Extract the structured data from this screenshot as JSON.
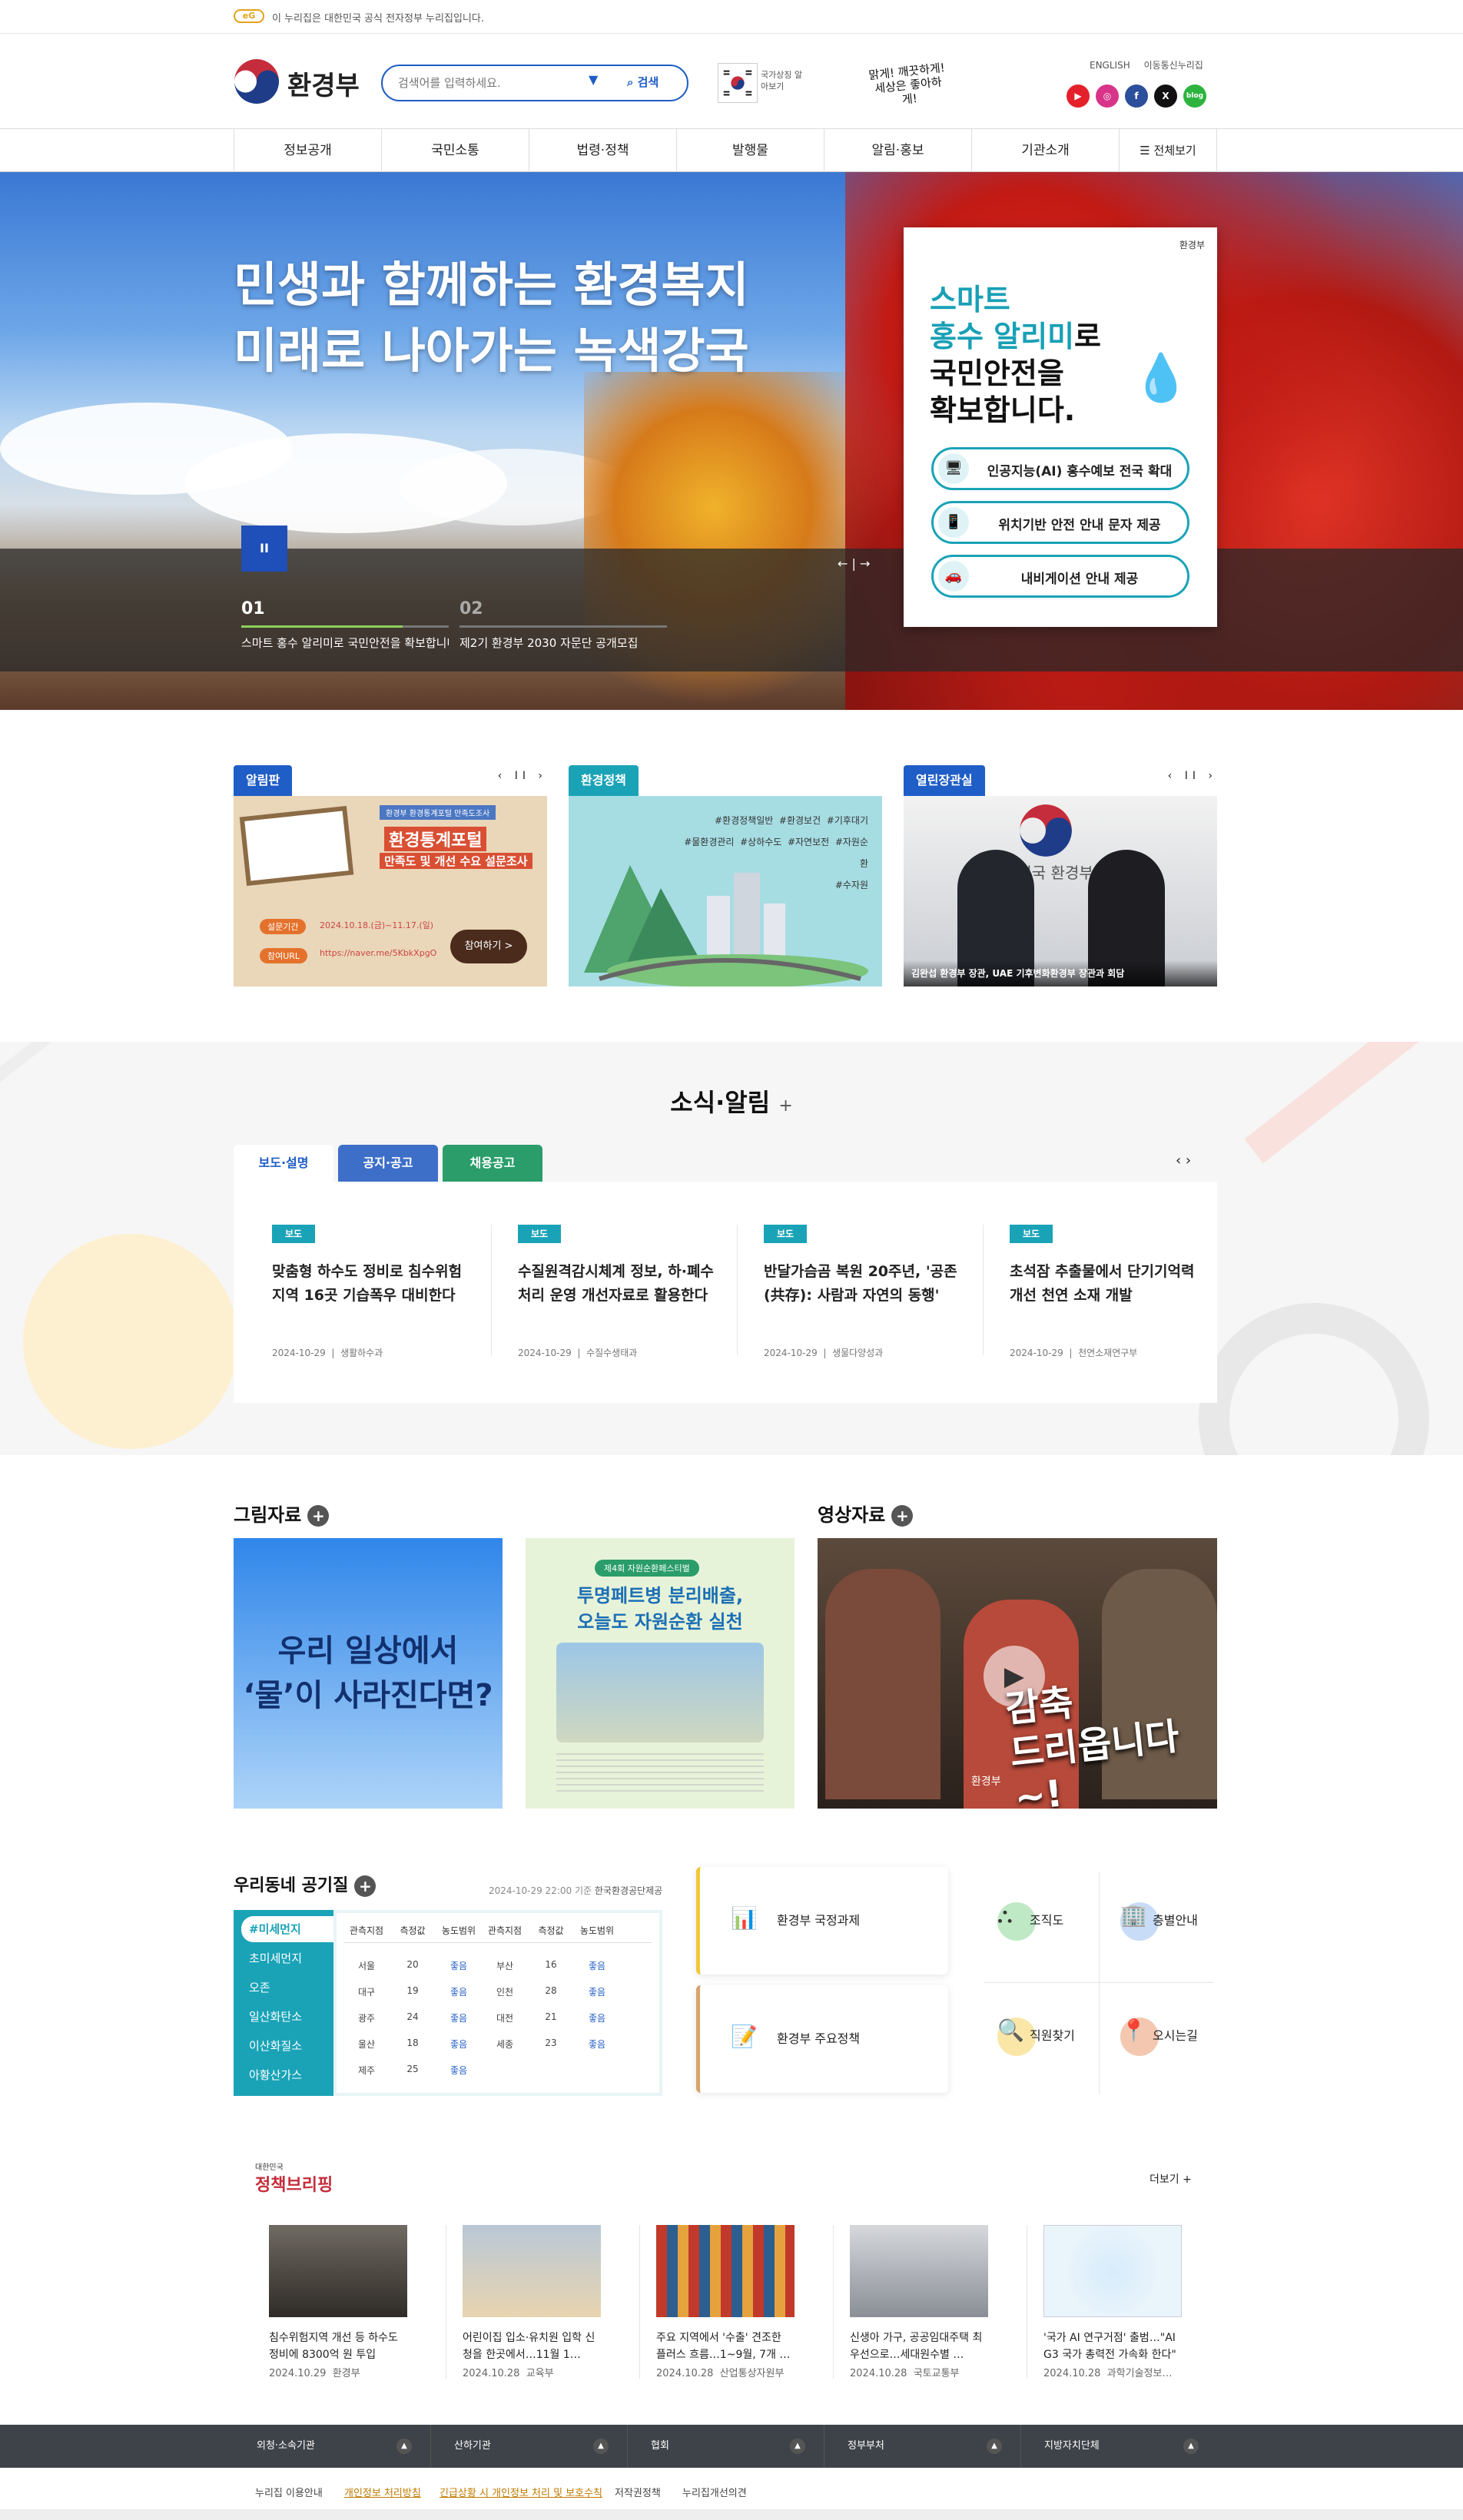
{
  "gov_bar": {
    "logo": "eG",
    "text": "이 누리집은 대한민국 공식 전자정부 누리집입니다."
  },
  "header": {
    "ministry": "환경부",
    "search_placeholder": "검색어를 입력하세요.",
    "search_button": "검색",
    "flag_text": "국가상징 알아보기",
    "slogan": "맑게! 깨끗하게! 세상은 좋아하게!",
    "links": [
      "ENGLISH",
      "이동통신누리집"
    ],
    "sns": [
      "YouTube",
      "Instagram",
      "Facebook",
      "X",
      "blog"
    ]
  },
  "gnb": {
    "items": [
      "정보공개",
      "국민소통",
      "법령·정책",
      "발행물",
      "알림·홍보",
      "기관소개"
    ],
    "all": "전체보기"
  },
  "hero": {
    "title_line1": "민생과 함께하는 환경복지",
    "title_line2": "미래로 나아가는 녹색강국",
    "pause": "II",
    "slides": [
      {
        "num": "01",
        "title": "스마트 홍수 알리미로 국민안전을 확보합니다"
      },
      {
        "num": "02",
        "title": "제2기 환경부 2030 자문단 공개모집"
      }
    ],
    "arrows": "← | →",
    "card": {
      "brand": "환경부",
      "title_l1": "스마트",
      "title_l2": "홍수 알리미",
      "title_l2b": "로",
      "title_l3": "국민안전을",
      "title_l4": "확보합니다.",
      "items": [
        "인공지능(AI) 홍수예보 전국 확대",
        "위치기반 안전 안내 문자 제공",
        "내비게이션 안내 제공"
      ]
    }
  },
  "banners": [
    {
      "tab": "알림판",
      "headline_top": "환경부 환경통계포털 만족도조사",
      "headline1": "환경통계포털",
      "headline2": "만족도 및 개선 수요 설문조사",
      "period_label": "설문기간",
      "period": "2024.10.18.(금)~11.17.(일)",
      "url_label": "참여URL",
      "url": "https://naver.me/5KbkXpgO",
      "button": "참여하기 >"
    },
    {
      "tab": "환경정책",
      "tags": [
        "#환경정책일반",
        "#환경보건",
        "#기후대기",
        "#물환경관리",
        "#상하수도",
        "#자연보전",
        "#자원순환",
        "#수자원"
      ]
    },
    {
      "tab": "열린장관실",
      "sign": "한민국 환경부",
      "caption": "김완섭 환경부 장관, UAE 기후변화환경부 장관과 회담"
    }
  ],
  "news": {
    "heading": "소식·알림",
    "tabs": [
      "보도·설명",
      "공지·공고",
      "채용공고"
    ],
    "items": [
      {
        "badge": "보도",
        "title": "맞춤형 하수도 정비로 침수위험지역 16곳 기습폭우 대비한다",
        "date": "2024-10-29",
        "dept": "생활하수과"
      },
      {
        "badge": "보도",
        "title": "수질원격감시체계 정보, 하·폐수처리 운영 개선자료로 활용한다",
        "date": "2024-10-29",
        "dept": "수질수생태과"
      },
      {
        "badge": "보도",
        "title": "반달가슴곰 복원 20주년, '공존(共存): 사람과 자연의 동행'",
        "date": "2024-10-29",
        "dept": "생물다양성과"
      },
      {
        "badge": "보도",
        "title": "초석잠 추출물에서 단기기억력 개선 천연 소재 개발",
        "date": "2024-10-29",
        "dept": "천연소재연구부"
      }
    ]
  },
  "gallery": {
    "pictures_heading": "그림자료",
    "video_heading": "영상자료",
    "pic1_text_l1": "우리 일상에서",
    "pic1_text_l2": "‘물’이 사라진다면?",
    "pic2_badge": "제4회 자원순환페스티벌",
    "pic2_title_l1": "투명페트병 분리배출,",
    "pic2_title_l2": "오늘도 자원순환 실천",
    "video_text_l1": "감축",
    "video_text_l2": "드리옵니다~!",
    "video_brand": "환경부"
  },
  "air": {
    "heading": "우리동네 공기질",
    "meta": "2024-10-29 22:00 기준",
    "source": "한국환경공단제공",
    "tabs": [
      "#미세먼지",
      "초미세먼지",
      "오존",
      "일산화탄소",
      "이산화질소",
      "아황산가스"
    ],
    "headers": [
      "관측지점",
      "측정값",
      "농도범위",
      "관측지점",
      "측정값",
      "농도범위"
    ],
    "rows": [
      [
        "서울",
        "20",
        "좋음",
        "부산",
        "16",
        "좋음"
      ],
      [
        "대구",
        "19",
        "좋음",
        "인천",
        "28",
        "좋음"
      ],
      [
        "광주",
        "24",
        "좋음",
        "대전",
        "21",
        "좋음"
      ],
      [
        "울산",
        "18",
        "좋음",
        "세종",
        "23",
        "좋음"
      ],
      [
        "제주",
        "25",
        "좋음",
        "",
        "",
        ""
      ]
    ]
  },
  "quick": {
    "big": [
      "환경부 국정과제",
      "환경부 주요정책"
    ],
    "small": [
      "조직도",
      "층별안내",
      "직원찾기",
      "오시는길"
    ]
  },
  "policy": {
    "logo_small": "대한민국",
    "logo": "정책브리핑",
    "more": "더보기 +",
    "items": [
      {
        "title": "침수위험지역 개선 등 하수도 정비에 8300억 원 투입",
        "date": "2024.10.29",
        "dept": "환경부"
      },
      {
        "title": "어린이집 입소·유치원 입학 신청을 한곳에서…11월 1…",
        "date": "2024.10.28",
        "dept": "교육부"
      },
      {
        "title": "주요 지역에서 '수출' 견조한 플러스 흐름…1~9월, 7개 …",
        "date": "2024.10.28",
        "dept": "산업통상자원부"
      },
      {
        "title": "신생아 가구, 공공임대주택 최우선으로…세대원수별 …",
        "date": "2024.10.28",
        "dept": "국토교통부"
      },
      {
        "title": "'국가 AI 연구거점' 출범…\"AI G3 국가 총력전 가속화 한다\"",
        "date": "2024.10.28",
        "dept": "과학기술정보…"
      }
    ]
  },
  "footer": {
    "related": [
      "외청·소속기관",
      "산하기관",
      "협회",
      "정부부처",
      "지방자치단체"
    ],
    "links": [
      "누리집 이용안내",
      "개인정보 처리방침",
      "긴급상황 시 개인정보 처리 및 보호수칙",
      "저작권정책",
      "누리집개선의견"
    ]
  },
  "colors": {
    "primary": "#1f5dc7",
    "teal": "#1aa3b7",
    "green": "#2a9d6a",
    "blue_tab": "#3d6fc9"
  }
}
